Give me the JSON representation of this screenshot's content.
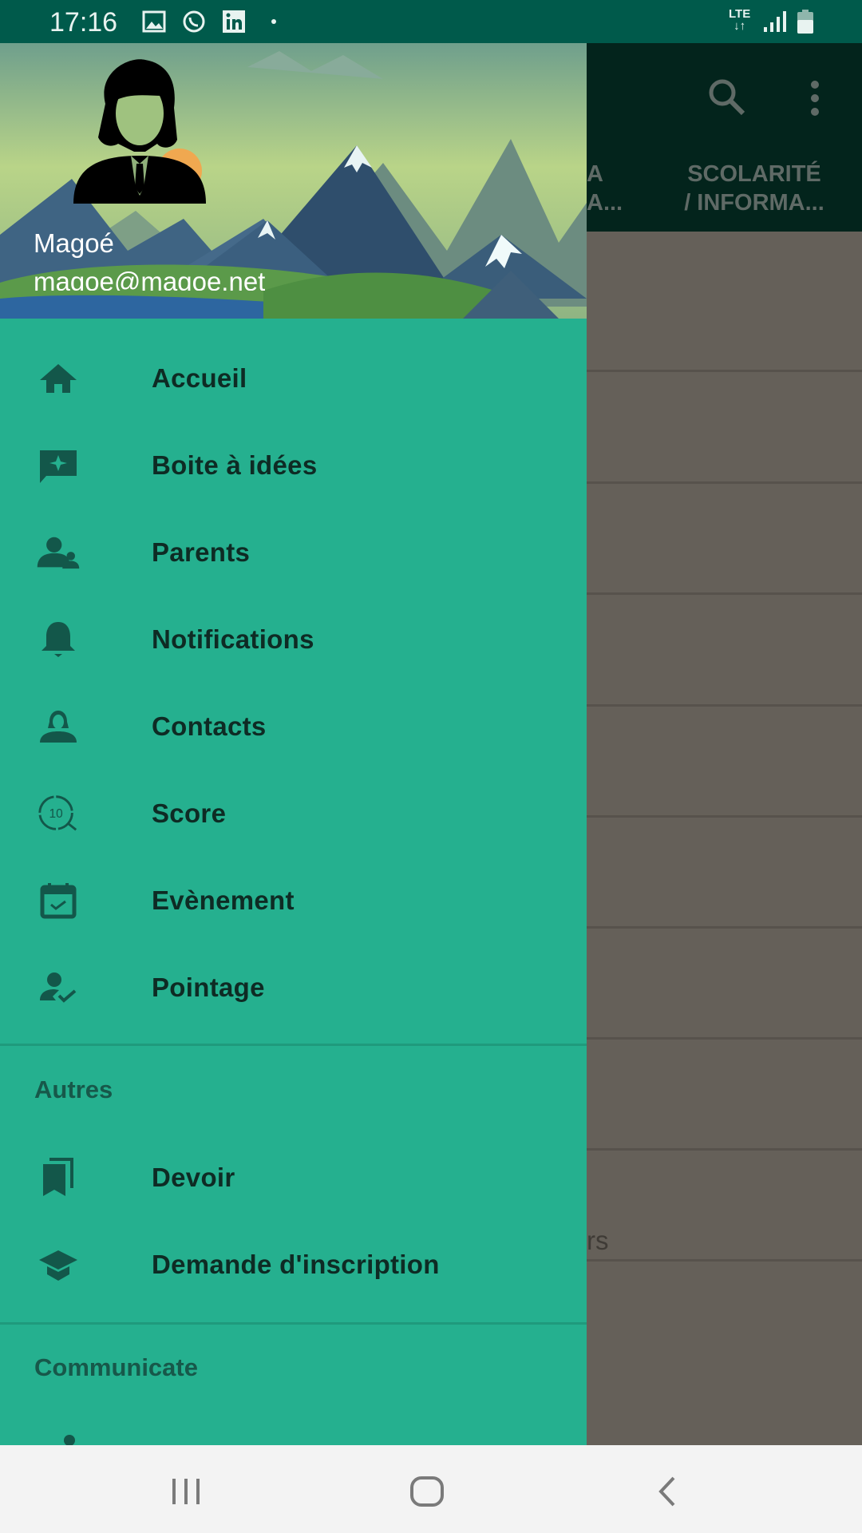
{
  "status_bar": {
    "time": "17:16",
    "network": "LTE",
    "icons": [
      "image-icon",
      "whatsapp-icon",
      "linkedin-icon",
      "dot-icon",
      "lte-icon",
      "signal-icon",
      "battery-icon"
    ]
  },
  "background": {
    "tabs": [
      "A\nA...",
      "SCOLARITÉ\n/ INFORMA..."
    ],
    "tab_partial_1": "A",
    "tab_partial_2": "A...",
    "tab_scolarite_1": "SCOLARITÉ",
    "tab_scolarite_2": "/ INFORMA...",
    "partial_text": "rs"
  },
  "drawer": {
    "user": {
      "name": "Magoé",
      "email": "magoe@magoe.net"
    },
    "items": [
      {
        "label": "Accueil",
        "icon": "home-icon"
      },
      {
        "label": "Boite à idées",
        "icon": "idea-message-icon"
      },
      {
        "label": "Parents",
        "icon": "parents-icon"
      },
      {
        "label": "Notifications",
        "icon": "bell-icon"
      },
      {
        "label": "Contacts",
        "icon": "contact-icon"
      },
      {
        "label": "Score",
        "icon": "score-icon"
      },
      {
        "label": "Evènement",
        "icon": "calendar-check-icon"
      },
      {
        "label": "Pointage",
        "icon": "person-check-icon"
      }
    ],
    "section_autres": "Autres",
    "autres_items": [
      {
        "label": "Devoir",
        "icon": "bookmarks-icon"
      },
      {
        "label": "Demande d'inscription",
        "icon": "graduation-cap-icon"
      }
    ],
    "section_communicate": "Communicate"
  },
  "colors": {
    "drawer": "#25b08f",
    "status_bar": "#005a4b",
    "icon": "#13574a",
    "toolbar": "#03241c",
    "scrim": "#656059"
  }
}
